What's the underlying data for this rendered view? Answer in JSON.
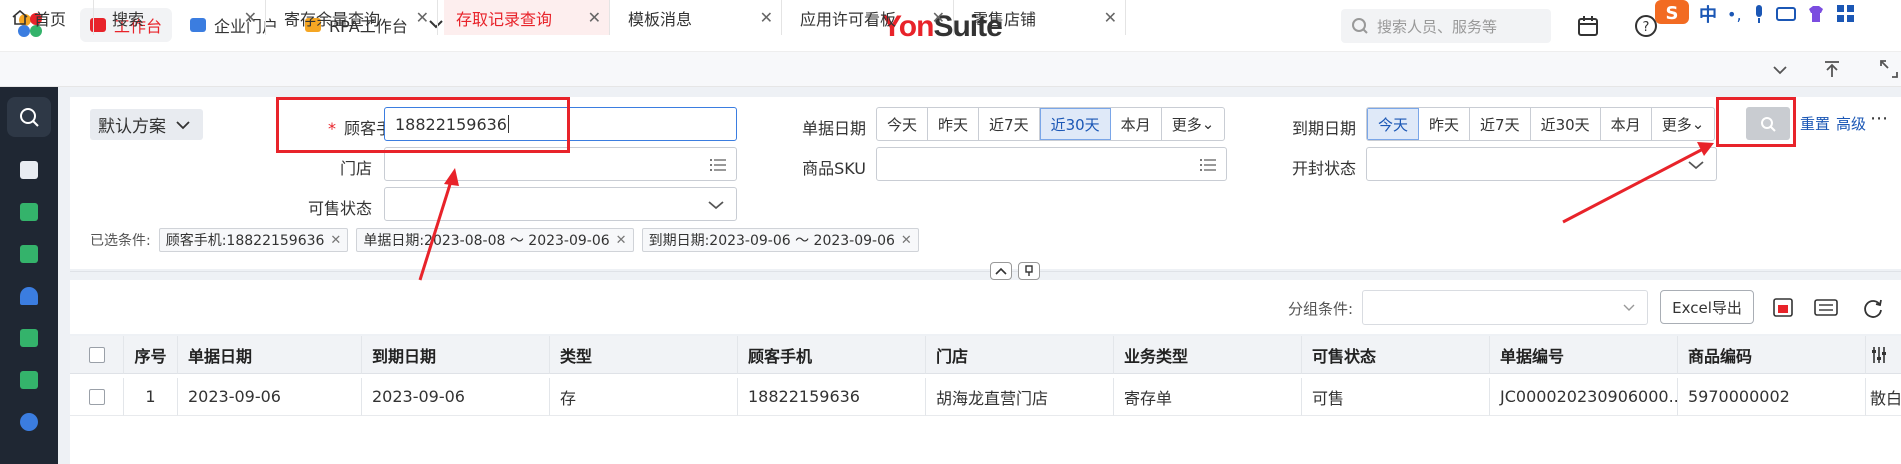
{
  "topbar": {
    "nav": [
      {
        "label": "工作台",
        "color": "#e8232a",
        "active": true
      },
      {
        "label": "企业门户",
        "color": "#3b7de0",
        "active": false
      },
      {
        "label": "RPA工作台",
        "color": "#f5a623",
        "active": false
      }
    ],
    "brand_red": "Yon",
    "brand_dark": "Suite",
    "search_placeholder": "搜索人员、服务等",
    "ime_label": "中"
  },
  "tabs": [
    {
      "label": "首页",
      "closable": false,
      "active": false
    },
    {
      "label": "搜索",
      "closable": true,
      "active": false
    },
    {
      "label": "寄存余量查询",
      "closable": true,
      "active": false
    },
    {
      "label": "存取记录查询",
      "closable": true,
      "active": true
    },
    {
      "label": "模板消息",
      "closable": true,
      "active": false
    },
    {
      "label": "应用许可看板",
      "closable": true,
      "active": false
    },
    {
      "label": "零售店铺",
      "closable": true,
      "active": false
    }
  ],
  "filter": {
    "scheme_label": "默认方案",
    "phone_label": "顾客手机",
    "phone_value": "18822159636",
    "store_label": "门店",
    "sale_status_label": "可售状态",
    "bill_date_label": "单据日期",
    "bill_date_options": [
      "今天",
      "昨天",
      "近7天",
      "近30天",
      "本月",
      "更多"
    ],
    "bill_date_selected": "近30天",
    "sku_label": "商品SKU",
    "due_date_label": "到期日期",
    "due_date_options": [
      "今天",
      "昨天",
      "近7天",
      "近30天",
      "本月",
      "更多"
    ],
    "due_date_selected": "今天",
    "open_status_label": "开封状态",
    "reset_label": "重置",
    "advanced_label": "高级",
    "selected_prefix": "已选条件:",
    "chips": [
      "顾客手机:18822159636",
      "单据日期:2023-08-08 ～ 2023-09-06",
      "到期日期:2023-09-06 ～ 2023-09-06"
    ]
  },
  "group": {
    "label": "分组条件:",
    "excel_label": "Excel导出"
  },
  "table": {
    "headers": [
      "序号",
      "单据日期",
      "到期日期",
      "类型",
      "顾客手机",
      "门店",
      "业务类型",
      "可售状态",
      "单据编号",
      "商品编码"
    ],
    "rows": [
      [
        "1",
        "2023-09-06",
        "2023-09-06",
        "存",
        "18822159636",
        "胡海龙直营门店",
        "寄存单",
        "可售",
        "JC000020230906000...",
        "5970000002"
      ]
    ],
    "overflow_cell": "散白"
  },
  "colors": {
    "accent_red": "#e8232a",
    "link_blue": "#1b57b5",
    "sidebar": "#1f2733"
  }
}
